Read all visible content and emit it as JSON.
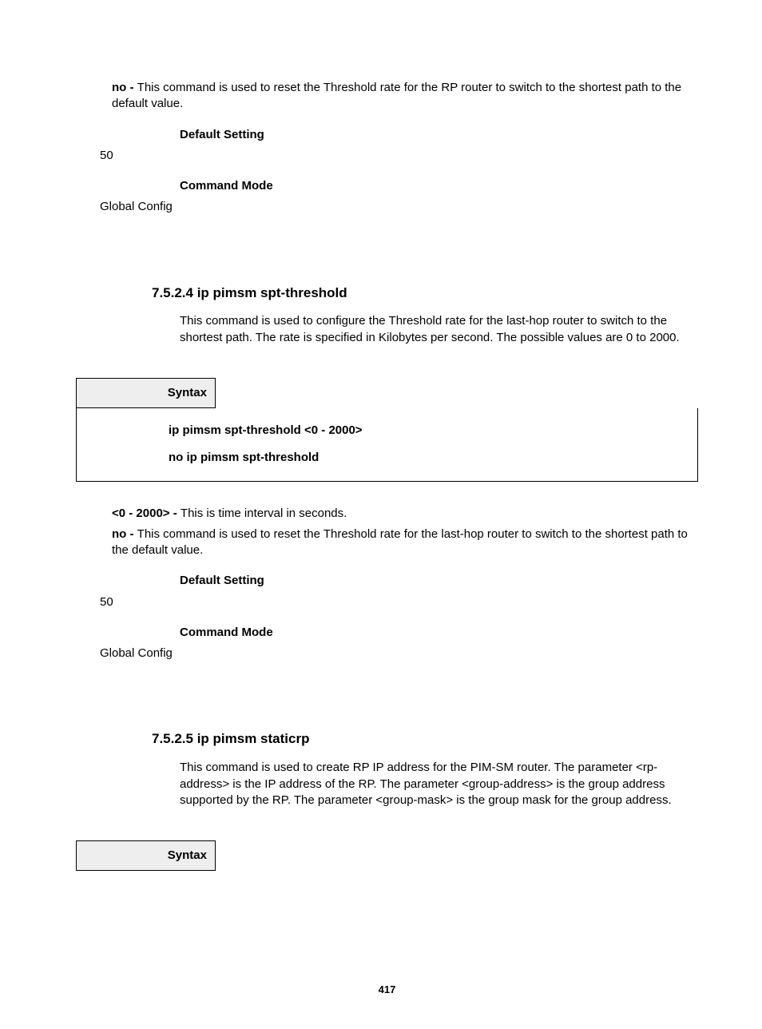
{
  "top_para": {
    "prefix": "no - ",
    "text": "This command is used to reset the Threshold rate for the RP router to switch to the shortest path to the default value."
  },
  "default_setting_label": "Default Setting",
  "default_setting_value_1": "50",
  "command_mode_label": "Command Mode",
  "command_mode_value_1": "Global Config",
  "section1": {
    "heading": "7.5.2.4 ip pimsm spt-threshold",
    "body": "This command is used to configure the Threshold rate for the last-hop router to switch to the shortest path. The rate is specified in Kilobytes per second. The possible values are 0 to 2000.",
    "syntax_label": "Syntax",
    "syntax_lines": [
      "ip pimsm spt-threshold <0 - 2000>",
      "no ip pimsm spt-threshold"
    ],
    "params": [
      {
        "prefix": "<0 - 2000> - ",
        "text": "This is time interval in seconds."
      },
      {
        "prefix": "no - ",
        "text": "This command is used to reset the Threshold rate for the last-hop router to switch to the shortest path to the default value."
      }
    ],
    "default_setting_value": "50",
    "command_mode_value": "Global Config"
  },
  "section2": {
    "heading": "7.5.2.5 ip pimsm staticrp",
    "body": "This command is used to create RP IP address for the PIM-SM router. The parameter <rp-address> is the IP address of the RP. The parameter <group-address> is the group address supported by the RP. The parameter <group-mask> is the group mask for the group address.",
    "syntax_label": "Syntax"
  },
  "page_number": "417"
}
